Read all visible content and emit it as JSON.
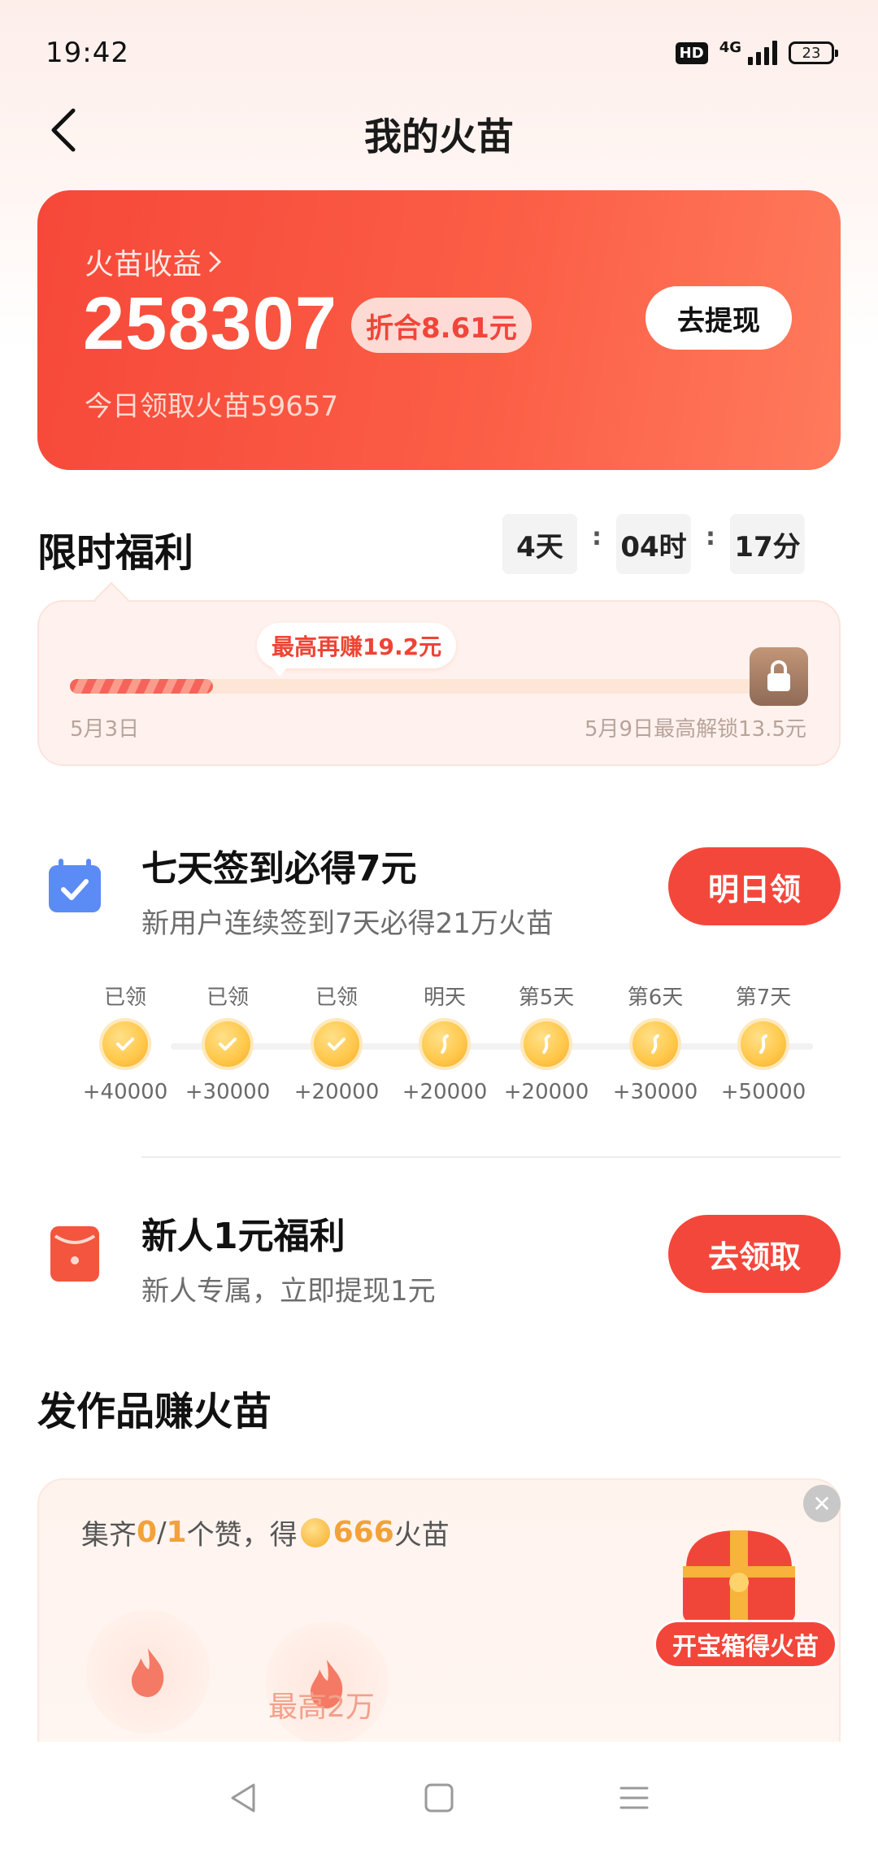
{
  "status_bar": {
    "time": "19:42",
    "hd": "HD",
    "network": "4G",
    "battery": "23"
  },
  "header": {
    "title": "我的火苗"
  },
  "earnings": {
    "title": "火苗收益",
    "amount": "258307",
    "convert": "折合8.61元",
    "today": "今日领取火苗59657",
    "withdraw": "去提现"
  },
  "limited": {
    "title": "限时福利",
    "countdown": [
      {
        "label": "4天"
      },
      {
        "label": "04时"
      },
      {
        "label": "17分"
      }
    ],
    "tip": "最高再赚19.2元",
    "start_date": "5月3日",
    "end_text": "5月9日最高解锁13.5元",
    "progress": 0.2
  },
  "checkin": {
    "title": "七天签到必得7元",
    "subtitle": "新用户连续签到7天必得21万火苗",
    "button": "明日领",
    "days": [
      {
        "label": "已领",
        "reward": "+40000",
        "claimed": true
      },
      {
        "label": "已领",
        "reward": "+30000",
        "claimed": true
      },
      {
        "label": "已领",
        "reward": "+20000",
        "claimed": true
      },
      {
        "label": "明天",
        "reward": "+20000",
        "claimed": false
      },
      {
        "label": "第5天",
        "reward": "+20000",
        "claimed": false
      },
      {
        "label": "第6天",
        "reward": "+30000",
        "claimed": false
      },
      {
        "label": "第7天",
        "reward": "+50000",
        "claimed": false
      }
    ]
  },
  "newbie": {
    "title": "新人1元福利",
    "subtitle": "新人专属，立即提现1元",
    "button": "去领取"
  },
  "works": {
    "title": "发作品赚火苗",
    "prefix": "集齐",
    "current": "0",
    "slash": "/",
    "target": "1",
    "mid": "个赞，得",
    "reward": "666",
    "suffix": "火苗",
    "chest": "开宝箱得火苗",
    "caption": "最高2万"
  },
  "colors": {
    "accent": "#f4473b",
    "gold": "#f6ac2b"
  }
}
